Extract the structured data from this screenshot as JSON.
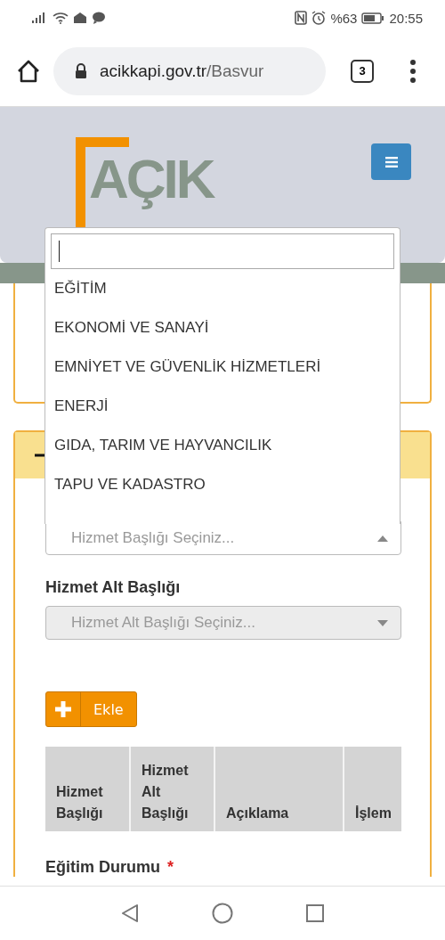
{
  "status_bar": {
    "battery": "%63",
    "time": "20:55"
  },
  "browser": {
    "url_host": "acikkapi.gov.tr",
    "url_path": "/Basvur",
    "tab_count": "3"
  },
  "header": {
    "logo": "AÇIK"
  },
  "section": {
    "expanded": true
  },
  "dropdown": {
    "options": [
      {
        "label": "EĞİTİM"
      },
      {
        "label": "EKONOMİ VE SANAYİ"
      },
      {
        "label": "EMNİYET VE GÜVENLİK HİZMETLERİ"
      },
      {
        "label": "ENERJİ"
      },
      {
        "label": "GIDA, TARIM VE HAYVANCILIK"
      },
      {
        "label": "TAPU VE KADASTRO"
      }
    ]
  },
  "service_title": {
    "placeholder": "Hizmet Başlığı Seçiniz...",
    "expanded": true
  },
  "service_subtitle": {
    "label": "Hizmet Alt Başlığı",
    "placeholder": "Hizmet Alt Başlığı Seçiniz...",
    "disabled": true
  },
  "add_button": {
    "label": "Ekle"
  },
  "table": {
    "columns": [
      "Hizmet Başlığı",
      "Hizmet Alt Başlığı",
      "Açıklama",
      "İşlem"
    ]
  },
  "education": {
    "label": "Eğitim Durumu",
    "required_mark": "*"
  }
}
